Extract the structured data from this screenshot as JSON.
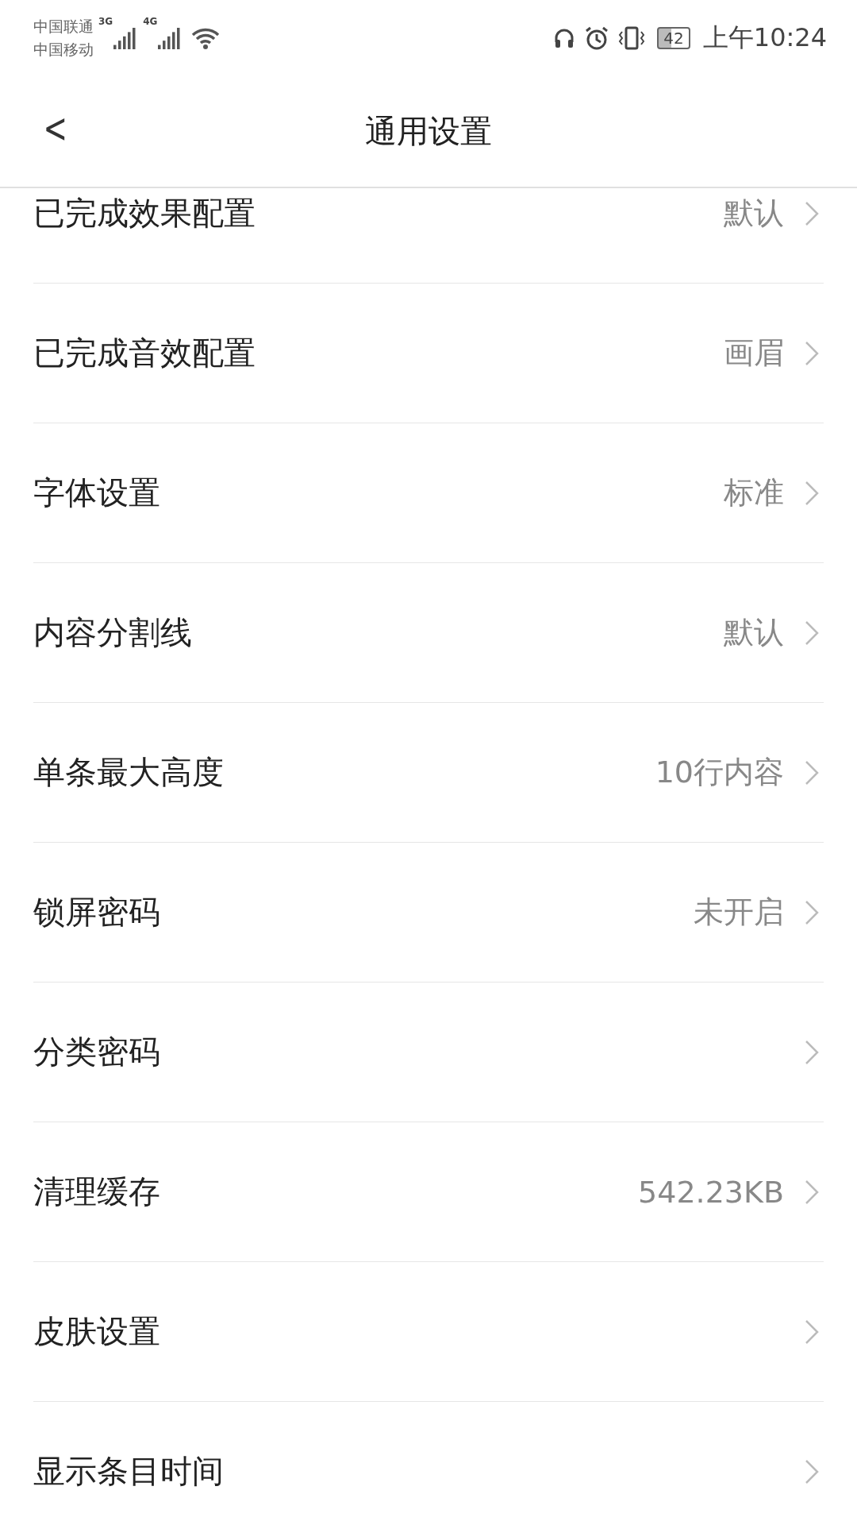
{
  "status_bar": {
    "carriers": [
      "中国联通",
      "中国移动"
    ],
    "network_labels": [
      "3G",
      "4G"
    ],
    "battery": "42",
    "time": "上午10:24"
  },
  "header": {
    "back": "<",
    "title": "通用设置"
  },
  "settings": [
    {
      "label": "已完成效果配置",
      "value": "默认"
    },
    {
      "label": "已完成音效配置",
      "value": "画眉"
    },
    {
      "label": "字体设置",
      "value": "标准"
    },
    {
      "label": "内容分割线",
      "value": "默认"
    },
    {
      "label": "单条最大高度",
      "value": "10行内容"
    },
    {
      "label": "锁屏密码",
      "value": "未开启"
    },
    {
      "label": "分类密码"
    },
    {
      "label": "清理缓存",
      "value": "542.23KB"
    },
    {
      "label": "皮肤设置"
    },
    {
      "label": "显示条目时间"
    }
  ]
}
